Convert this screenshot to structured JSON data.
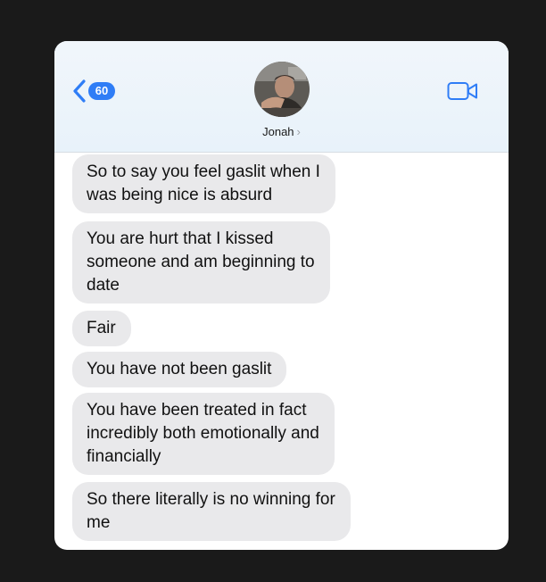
{
  "header": {
    "back_badge": "60",
    "contact_name": "Jonah",
    "contact_chevron": "›"
  },
  "icons": {
    "back": "chevron-left-icon",
    "video": "video-camera-icon",
    "avatar": "contact-photo"
  },
  "colors": {
    "accent": "#2f7df6",
    "bubble_received": "#e9e9eb",
    "header_bg": "#eaf3fb",
    "backdrop": "#1a1a1a"
  },
  "messages": [
    {
      "text": "So to say you feel gaslit when I\nwas being nice is absurd"
    },
    {
      "text": "You are hurt that I kissed\nsomeone and am beginning to\ndate"
    },
    {
      "text": "Fair"
    },
    {
      "text": "You have not been gaslit"
    },
    {
      "text": "You have been treated in fact\nincredibly both emotionally and\nfinancially"
    },
    {
      "text": "So there literally is no winning for\nme"
    }
  ]
}
